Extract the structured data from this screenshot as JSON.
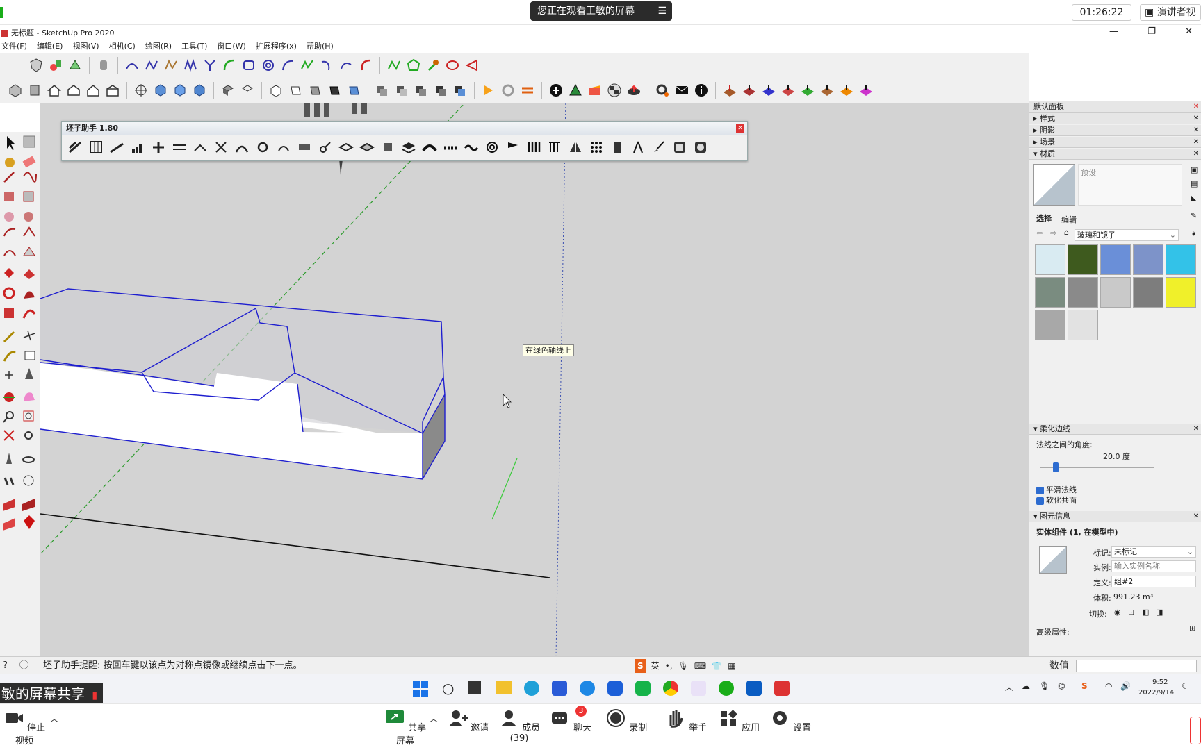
{
  "meeting": {
    "banner": "您正在观看王敏的屏幕",
    "timer": "01:26:22",
    "speaker_view": "演讲者视",
    "share_overlay": "敏的屏幕共享",
    "bottom_bar": {
      "stop_video": "停止视频",
      "share_screen": "共享屏幕",
      "invite": "邀请",
      "members": "成员(39)",
      "chat": "聊天",
      "chat_badge": "3",
      "record": "录制",
      "raise_hand": "举手",
      "apps": "应用",
      "settings": "设置"
    }
  },
  "sketchup": {
    "title": "无标题 - SketchUp Pro 2020",
    "menus": [
      "文件(F)",
      "编辑(E)",
      "视图(V)",
      "相机(C)",
      "绘图(R)",
      "工具(T)",
      "窗口(W)",
      "扩展程序(x)",
      "帮助(H)"
    ],
    "plugin_toolbar_title": "坯子助手 1.80",
    "tooltip": "在绿色轴线上",
    "status_text": "坯子助手提醒: 按回车键以该点为对称点镜像或继续点击下一点。",
    "measure_label": "数值"
  },
  "tray": {
    "title": "默认面板",
    "sections": {
      "styles": "样式",
      "shadows": "阴影",
      "scenes": "场景",
      "materials": "材质",
      "soften_edges": "柔化边线",
      "entity_info": "图元信息"
    },
    "materials": {
      "preset_label": "预设",
      "tab_select": "选择",
      "tab_edit": "编辑",
      "library": "玻璃和镜子",
      "swatch_colors": [
        "#d9ebf2",
        "#3e5a1e",
        "#6a8fd8",
        "#7d93c9",
        "#33c2e8",
        "#7a8c80",
        "#8a8a8a",
        "#c9c9c9",
        "#7d7d7d",
        "#f0f02a",
        "#a8a8a8",
        "#e2e2e2"
      ]
    },
    "soften": {
      "angle_label": "法线之间的角度:",
      "angle_value": "20.0 度",
      "smooth_normals": "平滑法线",
      "soften_coplanar": "软化共面"
    },
    "entity": {
      "heading": "实体组件 (1, 在模型中)",
      "tag_label": "标记:",
      "tag_value": "未标记",
      "instance_label": "实例:",
      "instance_placeholder": "输入实例名称",
      "definition_label": "定义:",
      "definition_value": "组#2",
      "volume_label": "体积:",
      "volume_value": "991.23 m³",
      "toggle_label": "切换:",
      "advanced_label": "高级属性:"
    }
  },
  "taskbar": {
    "time": "9:52",
    "date": "2022/9/14",
    "ime": "英"
  }
}
